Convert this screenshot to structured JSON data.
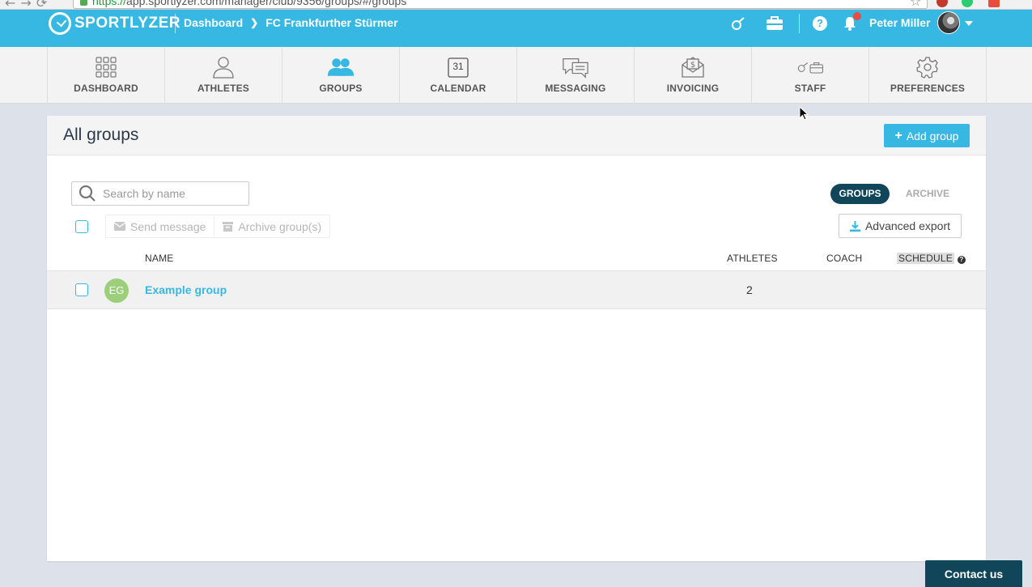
{
  "browser": {
    "url_scheme": "https://",
    "url_rest": "app.sportlyzer.com/manager/club/9356/groups/#/groups"
  },
  "header": {
    "logo_text": "SPORTLYZER",
    "breadcrumb": [
      "Dashboard",
      "FC Frankfurther Stürmer"
    ],
    "user_name": "Peter Miller",
    "icons": [
      "whistle-icon",
      "briefcase-icon",
      "help-icon",
      "bell-icon"
    ],
    "accent_color": "#36b8e3"
  },
  "nav": {
    "items": [
      {
        "label": "DASHBOARD",
        "icon": "grid-icon"
      },
      {
        "label": "ATHLETES",
        "icon": "person-icon"
      },
      {
        "label": "GROUPS",
        "icon": "people-icon",
        "active": true
      },
      {
        "label": "CALENDAR",
        "icon": "calendar-icon",
        "calendar_day": "31"
      },
      {
        "label": "MESSAGING",
        "icon": "chat-icon"
      },
      {
        "label": "INVOICING",
        "icon": "invoice-icon"
      },
      {
        "label": "STAFF",
        "icon": "staff-icon"
      },
      {
        "label": "PREFERENCES",
        "icon": "gear-icon"
      }
    ]
  },
  "page": {
    "title": "All groups",
    "add_button": "Add group",
    "search_placeholder": "Search by name",
    "tabs": {
      "groups": "GROUPS",
      "archive": "ARCHIVE"
    },
    "toolbar": {
      "send_message": "Send message",
      "archive_groups": "Archive group(s)"
    },
    "export_button": "Advanced export",
    "columns": {
      "name": "NAME",
      "athletes": "ATHLETES",
      "coach": "COACH",
      "schedule": "SCHEDULE"
    },
    "rows": [
      {
        "initials": "EG",
        "name": "Example group",
        "athletes": "2",
        "coach": "",
        "schedule": ""
      }
    ]
  },
  "contact_button": "Contact us",
  "colors": {
    "dark": "#11465a",
    "avatar_green": "#9ccf7a"
  }
}
